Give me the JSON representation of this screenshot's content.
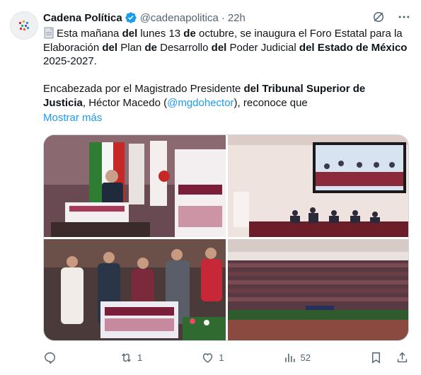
{
  "account": {
    "name": "Cadena Política",
    "handle": "@cadenapolitica",
    "separator": "·",
    "time": "22h"
  },
  "tweet": {
    "line1_pre": "Esta mañana ",
    "line1_b1": "del",
    "line1_mid": " lunes 13 ",
    "line1_b2": "de",
    "line1_post": " octubre, se inaugura el Foro Estatal para la",
    "line2_pre": "Elaboración ",
    "line2_b1": "del",
    "line2_mid1": " Plan ",
    "line2_b2": "de",
    "line2_mid2": " Desarrollo ",
    "line2_b3": "del",
    "line2_mid3": " Poder Judicial ",
    "line2_b4": "del Estado de México",
    "line3": "2025-2027.",
    "line4_pre": "Encabezada por el Magistrado Presidente ",
    "line4_b": "del Tribunal Superior de",
    "line5_b": "Justicia",
    "line5_pre": ", Héctor Macedo (",
    "line5_mention": "@mgdohector",
    "line5_post": "), reconoce que",
    "show_more": "Mostrar más"
  },
  "media": {
    "photos": [
      "photo-podium",
      "photo-auditorium-screen",
      "photo-group-standing",
      "photo-audience"
    ]
  },
  "actions": {
    "replies": "",
    "reposts": "1",
    "likes": "1",
    "views": "52"
  },
  "colors": {
    "accent": "#1d9bf0",
    "muted": "#536471",
    "text": "#0f1419"
  }
}
